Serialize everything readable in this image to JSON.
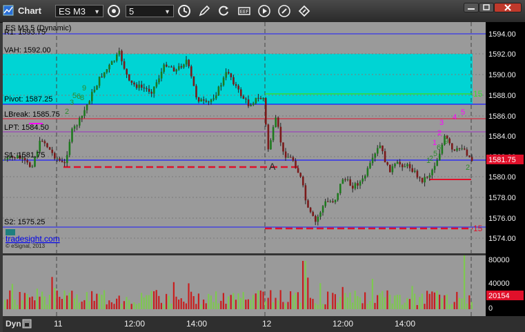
{
  "toolbar": {
    "app_title": "Chart",
    "symbol": "ES M3",
    "interval": "5"
  },
  "chart": {
    "header": "ES M3 5 (Dynamic)",
    "label_r1": "R1: 1593.75",
    "label_vah": "VAH: 1592.00",
    "label_pivot": "Pivot: 1587.25",
    "label_lbreak": "LBreak: 1585.75",
    "label_lpt": "LPT: 1584.50",
    "label_s1": "S1: 1581.75",
    "label_s2": "S2: 1575.25",
    "watermark_link": "tradesight.com",
    "copyright": "© eSignal, 2013",
    "marker_a": "A",
    "count_15_top": "15",
    "count_15_bottom": "15",
    "current_price": "1581.75",
    "price_ticks": [
      "1594.00",
      "1592.00",
      "1590.00",
      "1588.00",
      "1586.00",
      "1584.00",
      "1582.00",
      "1580.00",
      "1578.00",
      "1576.00",
      "1574.00"
    ],
    "volume_ticks": [
      "80000",
      "40000",
      "0"
    ],
    "volume_current": "20154",
    "time_ticks": [
      "11",
      "12:00",
      "14:00",
      "12",
      "12:00",
      "14:00"
    ],
    "status_label": "Dyn",
    "seq_green_left": [
      "2",
      "3",
      "5",
      "6",
      "8",
      "9"
    ],
    "seq_magenta": [
      "1",
      "2",
      "3",
      "4",
      "5"
    ],
    "seq_green_right": [
      "1",
      "2",
      "5",
      "6",
      "9",
      "2"
    ]
  },
  "colors": {
    "background": "#9a9a9a",
    "value_area": "#00d4d4",
    "pivot_line": "#1a1aff",
    "support_red": "#e0102a",
    "magenta": "#ff00ff",
    "green": "#2e8b2e"
  }
}
